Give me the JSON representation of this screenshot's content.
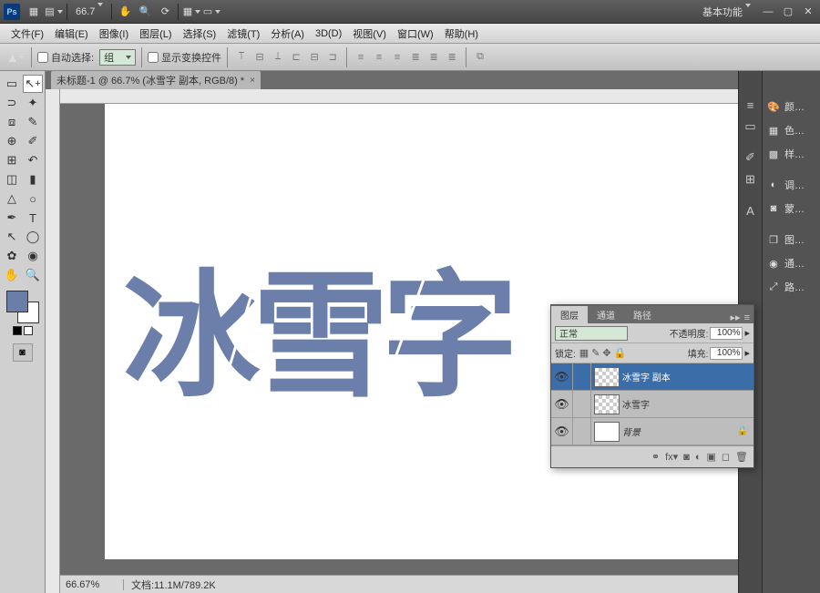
{
  "titlebar": {
    "zoom": "66.7",
    "workspace": "基本功能"
  },
  "menu": {
    "file": "文件(F)",
    "edit": "编辑(E)",
    "image": "图像(I)",
    "layer": "图层(L)",
    "select": "选择(S)",
    "filter": "滤镜(T)",
    "analysis": "分析(A)",
    "threed": "3D(D)",
    "view": "视图(V)",
    "window": "窗口(W)",
    "help": "帮助(H)"
  },
  "options": {
    "autoselect": "自动选择:",
    "group": "组",
    "showtransform": "显示变换控件"
  },
  "doc": {
    "tab": "未标题-1 @ 66.7% (冰雪字 副本, RGB/8) *"
  },
  "canvas": {
    "text": "冰雪字"
  },
  "layers": {
    "tab1": "图层",
    "tab2": "通道",
    "tab3": "路径",
    "blend": "正常",
    "opacity_label": "不透明度:",
    "opacity": "100%",
    "lock_label": "锁定:",
    "fill_label": "填充:",
    "fill": "100%",
    "layer1": "冰雪字 副本",
    "layer2": "冰雪字",
    "layer3": "背景"
  },
  "dock": {
    "p1": "颜…",
    "p2": "色…",
    "p3": "样…",
    "p4": "调…",
    "p5": "蒙…",
    "p6": "图…",
    "p7": "通…",
    "p8": "路…"
  },
  "status": {
    "zoom": "66.67%",
    "docsize": "文档:11.1M/789.2K"
  }
}
